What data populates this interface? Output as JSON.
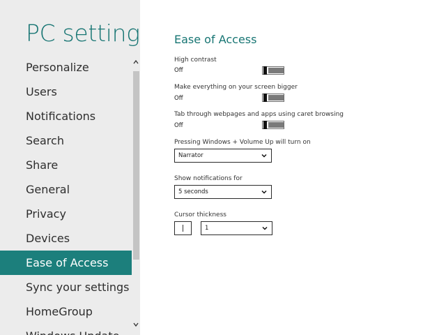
{
  "nav": {
    "title": "PC settings",
    "items": [
      {
        "label": "Personalize"
      },
      {
        "label": "Users"
      },
      {
        "label": "Notifications"
      },
      {
        "label": "Search"
      },
      {
        "label": "Share"
      },
      {
        "label": "General"
      },
      {
        "label": "Privacy"
      },
      {
        "label": "Devices"
      },
      {
        "label": "Ease of Access"
      },
      {
        "label": "Sync your settings"
      },
      {
        "label": "HomeGroup"
      },
      {
        "label": "Windows Update"
      }
    ],
    "selected_item": "Ease of Access",
    "accent_color": "#1c7f7c",
    "title_color": "#177573",
    "background_color": "#ececec"
  },
  "icons": {
    "scroll_up": "chevron-up-icon",
    "scroll_down": "chevron-down-icon",
    "dropdown_arrow": "chevron-down-icon"
  },
  "content": {
    "heading": "Ease of Access",
    "high_contrast": {
      "label": "High contrast",
      "state": "Off"
    },
    "bigger_screen": {
      "label": "Make everything on your screen bigger",
      "state": "Off"
    },
    "caret_browsing": {
      "label": "Tab through webpages and apps using caret browsing",
      "state": "Off"
    },
    "windows_volume": {
      "label": "Pressing Windows + Volume Up will turn on",
      "value": "Narrator"
    },
    "notifications": {
      "label": "Show notifications for",
      "value": "5 seconds"
    },
    "cursor": {
      "label": "Cursor thickness",
      "value": "1"
    }
  }
}
